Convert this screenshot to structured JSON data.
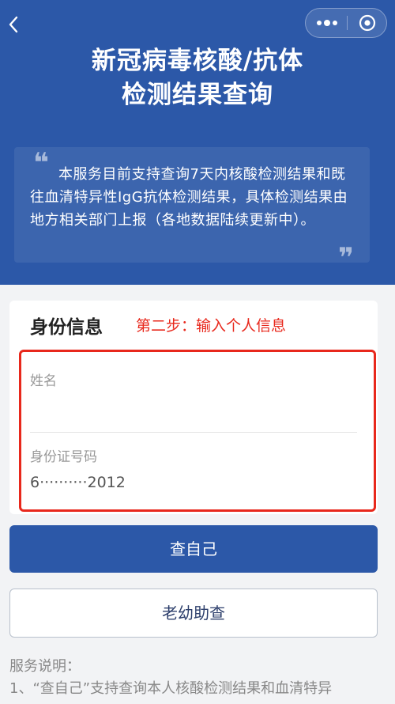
{
  "header": {
    "title_line1": "新冠病毒核酸/抗体",
    "title_line2": "检测结果查询",
    "notice": "本服务目前支持查询7天内核酸检测结果和既往血清特异性IgG抗体检测结果，具体检测结果由地方相关部门上报（各地数据陆续更新中）。",
    "quote_open": "❝",
    "quote_close": "❞"
  },
  "nav": {
    "back_icon": "chevron-left-icon",
    "more_icon": "more-dots-icon",
    "close_icon": "target-close-icon"
  },
  "form": {
    "title": "身份信息",
    "step_note": "第二步：输入个人信息",
    "name_label": "姓名",
    "name_value": "",
    "id_label": "身份证号码",
    "id_value": "6··········2012"
  },
  "buttons": {
    "query_self": "查自己",
    "query_family": "老幼助查"
  },
  "service": {
    "title": "服务说明：",
    "item1": "1、“查自己”支持查询本人核酸检测结果和血清特异"
  },
  "colors": {
    "primary": "#2c58a8",
    "highlight": "#e8281c"
  }
}
